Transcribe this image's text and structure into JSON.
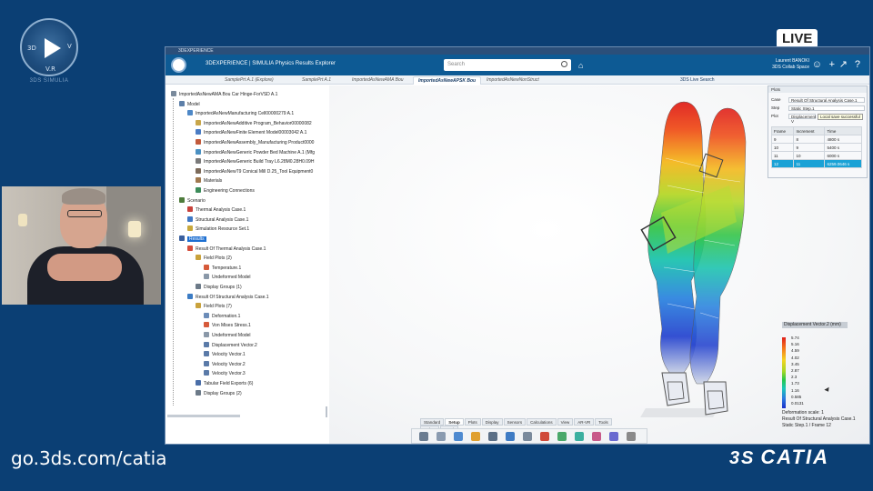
{
  "branding": {
    "badge_left": "3D",
    "badge_right": "V",
    "badge_bottom": "V.R",
    "badge_caption": "3DS SIMULIA",
    "live": "LIVE",
    "url": "go.3ds.com/catia",
    "catia": "CATIA",
    "ds_mark": "3S"
  },
  "app": {
    "title_strip": "3DEXPERIENCE",
    "brand": "3DEXPERIENCE | SIMULIA Physics Results Explorer",
    "search_placeholder": "Search",
    "user_name": "Laurent BANOKI",
    "user_space": "3DS Collab Space",
    "tabs": [
      "SamplePrt A.1 (Explore)",
      "SamplePrt A.1",
      "ImportedAsNewAMA Bou",
      "ImportedAsNewAPSK Bou",
      "ImportedAsNewNonStruct"
    ],
    "tab_extra": "3DS Live Search",
    "topbar_icons": [
      "person-icon",
      "plus-icon",
      "share-icon",
      "help-icon"
    ]
  },
  "tree": [
    {
      "label": "ImportedAsNewAMA Bou Car Hinge-ForVSD A.1",
      "indent": 0,
      "color": "#7a8a9c"
    },
    {
      "label": "Model",
      "indent": 1,
      "color": "#5d7fa8"
    },
    {
      "label": "ImportedAsNewManufacturing Cell00000279 A.1",
      "indent": 2,
      "color": "#4e88c7"
    },
    {
      "label": "ImportedAsNewAdditive Program_Behavior00000082",
      "indent": 3,
      "color": "#c8a64a"
    },
    {
      "label": "ImportedAsNewFinite Element Model00003042 A.1",
      "indent": 3,
      "color": "#4a7cc4"
    },
    {
      "label": "ImportedAsNewAssembly_Manufacturing Product0000",
      "indent": 3,
      "color": "#c25a3b"
    },
    {
      "label": "ImportedAsNewGeneric Powder Bed Machine A.1 (Mfg",
      "indent": 3,
      "color": "#4a90c2"
    },
    {
      "label": "ImportedAsNewGeneric Build Tray L6.28M0.28H0.09H",
      "indent": 3,
      "color": "#7a7a7a"
    },
    {
      "label": "ImportedAsNewT9 Conical Mill D.25_Tool Equipment0",
      "indent": 3,
      "color": "#7c6a5a"
    },
    {
      "label": "Materials",
      "indent": 3,
      "color": "#a0784f"
    },
    {
      "label": "Engineering Connections",
      "indent": 3,
      "color": "#3c8c5a"
    },
    {
      "label": "Scenario",
      "indent": 1,
      "color": "#4e7c3c"
    },
    {
      "label": "Thermal Analysis Case.1",
      "indent": 2,
      "color": "#c8423c"
    },
    {
      "label": "Structural Analysis Case.1",
      "indent": 2,
      "color": "#3f78c4"
    },
    {
      "label": "Simulation Resource Set.1",
      "indent": 2,
      "color": "#c8a83c"
    },
    {
      "label": "Results",
      "indent": 1,
      "color": "#3a5f9e",
      "selected": true
    },
    {
      "label": "Result Of Thermal Analysis Case.1",
      "indent": 2,
      "color": "#d44d3b"
    },
    {
      "label": "Field Plots (2)",
      "indent": 3,
      "color": "#c9a23c"
    },
    {
      "label": "Temperature.1",
      "indent": 4,
      "color": "#d65a3a"
    },
    {
      "label": "Undeformed Model",
      "indent": 4,
      "color": "#8a98a8"
    },
    {
      "label": "Display Groups (1)",
      "indent": 3,
      "color": "#6c7a88"
    },
    {
      "label": "Result Of Structural Analysis Case.1",
      "indent": 2,
      "color": "#3c7cc4"
    },
    {
      "label": "Field Plots (7)",
      "indent": 3,
      "color": "#c9a23c"
    },
    {
      "label": "Deformation.1",
      "indent": 4,
      "color": "#6b8cb8"
    },
    {
      "label": "Von Mises Stress.1",
      "indent": 4,
      "color": "#d65a3a"
    },
    {
      "label": "Undeformed Model",
      "indent": 4,
      "color": "#8a98a8"
    },
    {
      "label": "Displacement Vector.2",
      "indent": 4,
      "color": "#5a7aa8"
    },
    {
      "label": "Velocity Vector.1",
      "indent": 4,
      "color": "#5a7aa8"
    },
    {
      "label": "Velocity Vector.2",
      "indent": 4,
      "color": "#5a7aa8"
    },
    {
      "label": "Velocity Vector.3",
      "indent": 4,
      "color": "#5a7aa8"
    },
    {
      "label": "Tabular Field Exports (6)",
      "indent": 3,
      "color": "#4a6ea8"
    },
    {
      "label": "Display Groups (2)",
      "indent": 3,
      "color": "#6c7a88"
    }
  ],
  "params": {
    "title": "Plots",
    "case_label": "Case",
    "case_value": "Result Of Structural Analysis Case.1",
    "step_label": "Step",
    "step_value": "Static Step.1",
    "plot_label": "Plot",
    "plot_value": "Displacement V",
    "tooltip": "Local save successful",
    "table_headers": [
      "Frame",
      "Increment",
      "Time"
    ],
    "table_rows": [
      {
        "frame": "9",
        "inc": "8",
        "time": "4800 s",
        "hl": false
      },
      {
        "frame": "10",
        "inc": "9",
        "time": "5400 s",
        "hl": false
      },
      {
        "frame": "11",
        "inc": "10",
        "time": "6000 s",
        "hl": false
      },
      {
        "frame": "12",
        "inc": "11",
        "time": "6259.0646 s",
        "hl": true
      }
    ]
  },
  "legend": {
    "title": "Displacement Vector.2 (mm)",
    "values": [
      "5.74",
      "5.16",
      "4.59",
      "4.02",
      "3.45",
      "2.87",
      "2.3",
      "1.73",
      "1.16",
      "0.585",
      "0.0131"
    ],
    "deformation": "Deformation scale: 1",
    "result": "Result Of Structural Analysis Case.1",
    "frame": "Static Step.1 / Frame 12",
    "colors": [
      "#e0201c",
      "#f57a1c",
      "#f4d320",
      "#a4d624",
      "#27c74a",
      "#1bc7b8",
      "#2b7be0",
      "#1a2fc8"
    ]
  },
  "actionbar": {
    "tabs": [
      "Standard",
      "Setup",
      "Plots",
      "Display",
      "Sensors",
      "Calculations",
      "View",
      "AR-VR",
      "Tools",
      "Debug",
      "Touch"
    ],
    "active_tab": "Setup",
    "icons": [
      "undo-icon",
      "cube-icon",
      "model-icon",
      "palette-icon",
      "camera-icon",
      "table-icon",
      "probe-icon",
      "axis-icon",
      "animate-icon",
      "sensor-icon",
      "clip-icon",
      "compare-icon",
      "settings-icon"
    ]
  }
}
